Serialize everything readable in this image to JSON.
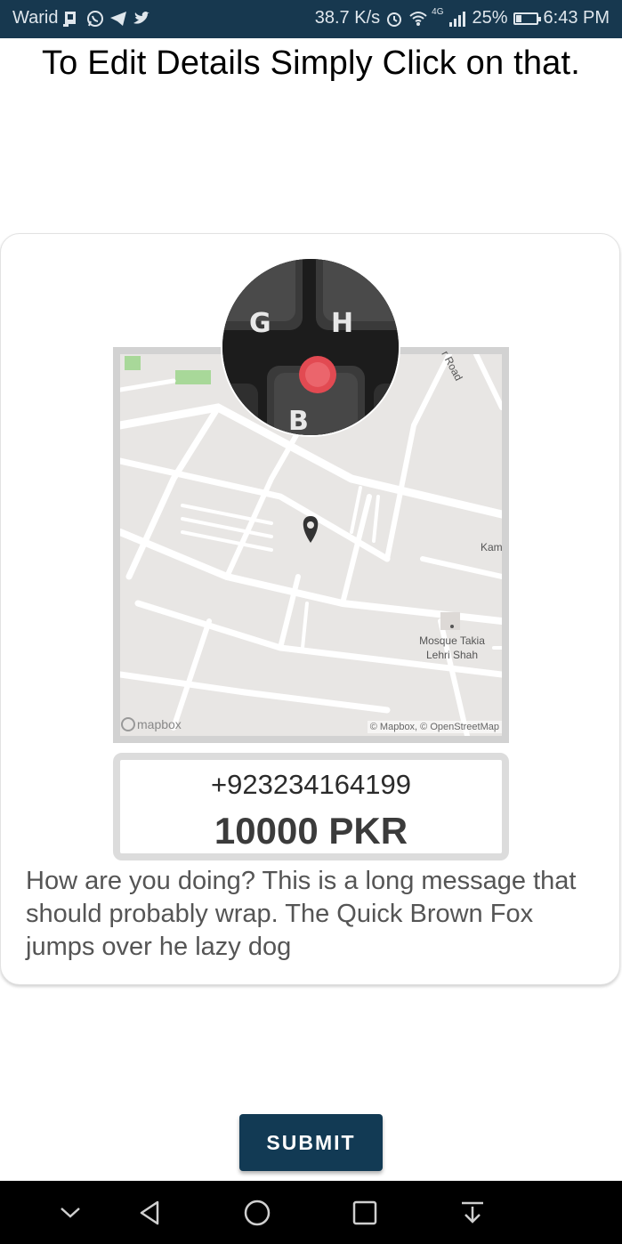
{
  "status_bar": {
    "carrier": "Warid",
    "net_speed": "38.7 K/s",
    "network_type": "4G",
    "battery_percent": "25%",
    "battery_level": 0.25,
    "time": "6:43 PM",
    "icons": [
      "sim-icon",
      "whatsapp-icon",
      "telegram-icon",
      "twitter-icon",
      "alarm-icon",
      "wifi-icon",
      "signal-icon",
      "battery-icon"
    ]
  },
  "page": {
    "title": "To Edit Details Simply Click on that."
  },
  "card": {
    "map": {
      "road_label": "r Road",
      "edge_label": "Kam",
      "poi_line1": "Mosque Takia",
      "poi_line2": "Lehri Shah",
      "logo_text": "mapbox",
      "attribution": "© Mapbox, © OpenStreetMap"
    },
    "phone": "+923234164199",
    "amount": "10000 PKR",
    "message": "How are you doing? This is a long message that should probably wrap. The Quick Brown Fox jumps over he lazy dog"
  },
  "actions": {
    "submit_label": "SUBMIT"
  },
  "colors": {
    "status_bar": "#17384f",
    "button": "#123a54",
    "map_bg": "#e8e6e4",
    "map_road": "#ffffff",
    "map_park": "#a8d899"
  }
}
